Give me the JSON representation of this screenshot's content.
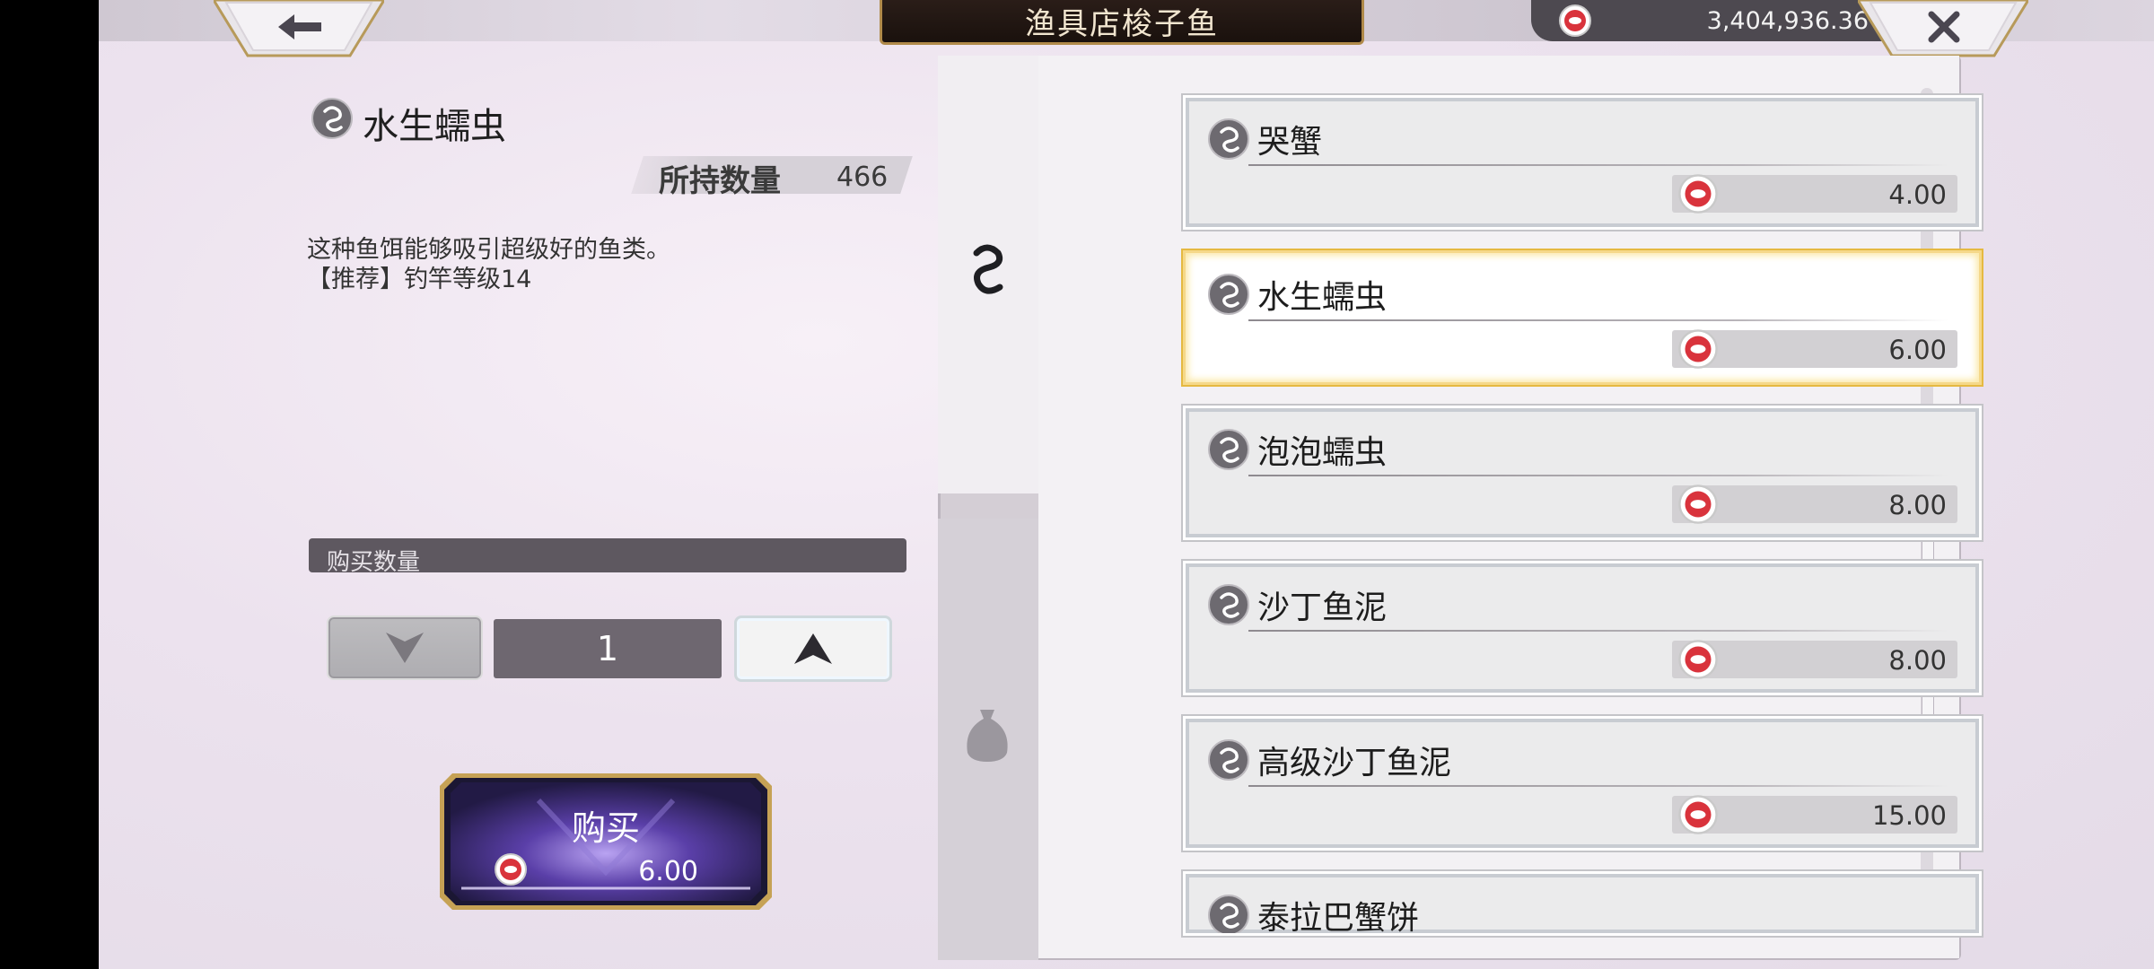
{
  "header": {
    "title": "渔具店梭子鱼",
    "currency_amount": "3,404,936.36",
    "back_icon": "arrow-left-icon",
    "close_icon": "close-icon"
  },
  "detail": {
    "name": "水生蠕虫",
    "owned_label": "所持数量",
    "owned_value": "466",
    "description": [
      "这种鱼饵能够吸引超级好的鱼类。",
      "【推荐】钓竿等级14"
    ],
    "quantity_label": "购买数量",
    "quantity_value": "1",
    "buy_label": "购买",
    "buy_price": "6.00"
  },
  "tabs": [
    {
      "icon": "worm-bait-icon",
      "active": true
    },
    {
      "icon": "bag-icon",
      "active": false
    }
  ],
  "items": [
    {
      "name": "哭蟹",
      "price": "4.00",
      "selected": false
    },
    {
      "name": "水生蠕虫",
      "price": "6.00",
      "selected": true
    },
    {
      "name": "泡泡蠕虫",
      "price": "8.00",
      "selected": false
    },
    {
      "name": "沙丁鱼泥",
      "price": "8.00",
      "selected": false
    },
    {
      "name": "高级沙丁鱼泥",
      "price": "15.00",
      "selected": false
    },
    {
      "name": "泰拉巴蟹饼",
      "price": "",
      "selected": false
    }
  ],
  "colors": {
    "accent_gold": "#e5b941",
    "coin_red": "#d9333c",
    "title_plate": "#1a110d"
  }
}
